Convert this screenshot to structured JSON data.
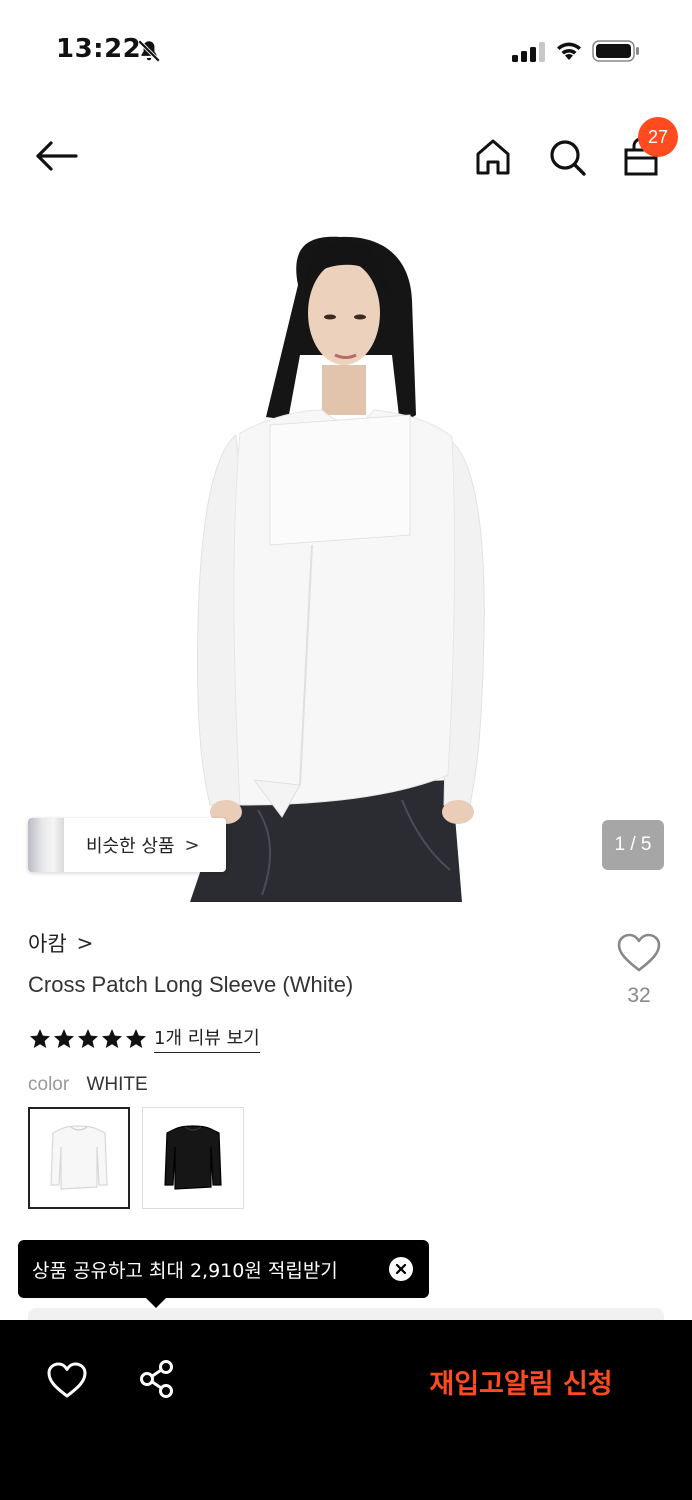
{
  "status_bar": {
    "time": "13:22",
    "icons": [
      "bell-muted-icon",
      "signal-icon",
      "wifi-icon",
      "battery-icon"
    ]
  },
  "nav": {
    "icons": [
      "back-arrow-icon",
      "home-icon",
      "search-icon",
      "shopping-bag-icon"
    ],
    "cart_count": "27",
    "badge_color": "#ff4b1f"
  },
  "gallery": {
    "similar_label": "비슷한 상품",
    "similar_chevron": ">",
    "page_indicator": "1 / 5"
  },
  "product": {
    "brand": "아캄",
    "brand_chevron": ">",
    "title": "Cross Patch Long Sleeve (White)",
    "like_count": "32",
    "rating_stars": 5,
    "review_link": "1개 리뷰 보기",
    "color_label": "color",
    "color_value": "WHITE",
    "swatches": [
      "white",
      "black"
    ]
  },
  "tooltip": {
    "text": "상품 공유하고 최대 2,910원 적립받기"
  },
  "bottom_bar": {
    "restock_label": "재입고알림 신청",
    "accent_color": "#ff4b1f",
    "icons": [
      "heart-icon",
      "share-icon"
    ]
  }
}
